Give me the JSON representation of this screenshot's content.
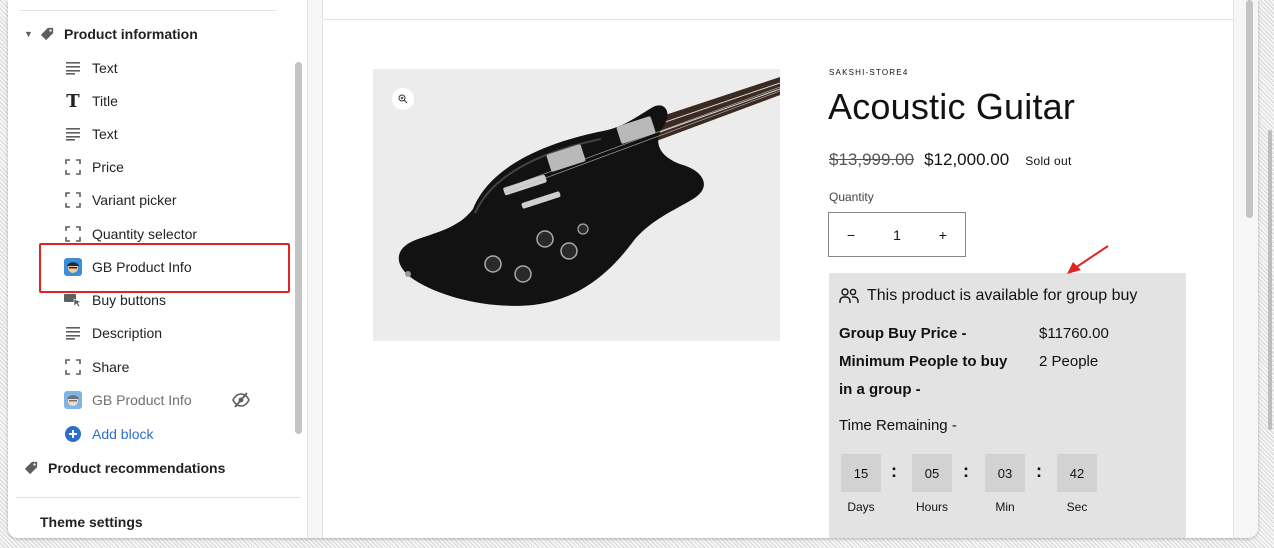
{
  "sidebar": {
    "section_product_info": "Product information",
    "items": [
      {
        "label": "Text",
        "icon": "text-lines-icon"
      },
      {
        "label": "Title",
        "icon": "title-t-icon"
      },
      {
        "label": "Text",
        "icon": "text-lines-icon"
      },
      {
        "label": "Price",
        "icon": "dashed-square-icon"
      },
      {
        "label": "Variant picker",
        "icon": "dashed-square-icon"
      },
      {
        "label": "Quantity selector",
        "icon": "dashed-square-icon"
      },
      {
        "label": "GB Product Info",
        "icon": "gb-app-icon"
      },
      {
        "label": "Buy buttons",
        "icon": "buy-buttons-icon"
      },
      {
        "label": "Description",
        "icon": "text-lines-icon"
      },
      {
        "label": "Share",
        "icon": "dashed-square-icon"
      },
      {
        "label": "GB Product Info",
        "icon": "gb-app-icon",
        "hidden": true
      },
      {
        "label": "Add block",
        "icon": "plus-circle-icon"
      }
    ],
    "section_recommendations": "Product recommendations",
    "theme_settings": "Theme settings"
  },
  "product": {
    "vendor": "SAKSHI-STORE4",
    "title": "Acoustic Guitar",
    "compare_price": "$13,999.00",
    "price": "$12,000.00",
    "badge": "Sold out",
    "quantity_label": "Quantity",
    "quantity_value": "1",
    "minus": "−",
    "plus": "+"
  },
  "group_buy": {
    "heading": "This product is available for group buy",
    "price_label": "Group Buy Price -",
    "price_value": "$11760.00",
    "min_label_line1": "Minimum People to buy",
    "min_label_line2": "in a group -",
    "min_value": "2 People",
    "time_label": "Time Remaining -",
    "countdown": [
      {
        "value": "15",
        "label": "Days"
      },
      {
        "value": "05",
        "label": "Hours"
      },
      {
        "value": "03",
        "label": "Min"
      },
      {
        "value": "42",
        "label": "Sec"
      }
    ],
    "separator": ":"
  },
  "colors": {
    "highlight": "#e02424",
    "accent_blue": "#2c6ecb",
    "gb_background": "#e3e3e3"
  }
}
